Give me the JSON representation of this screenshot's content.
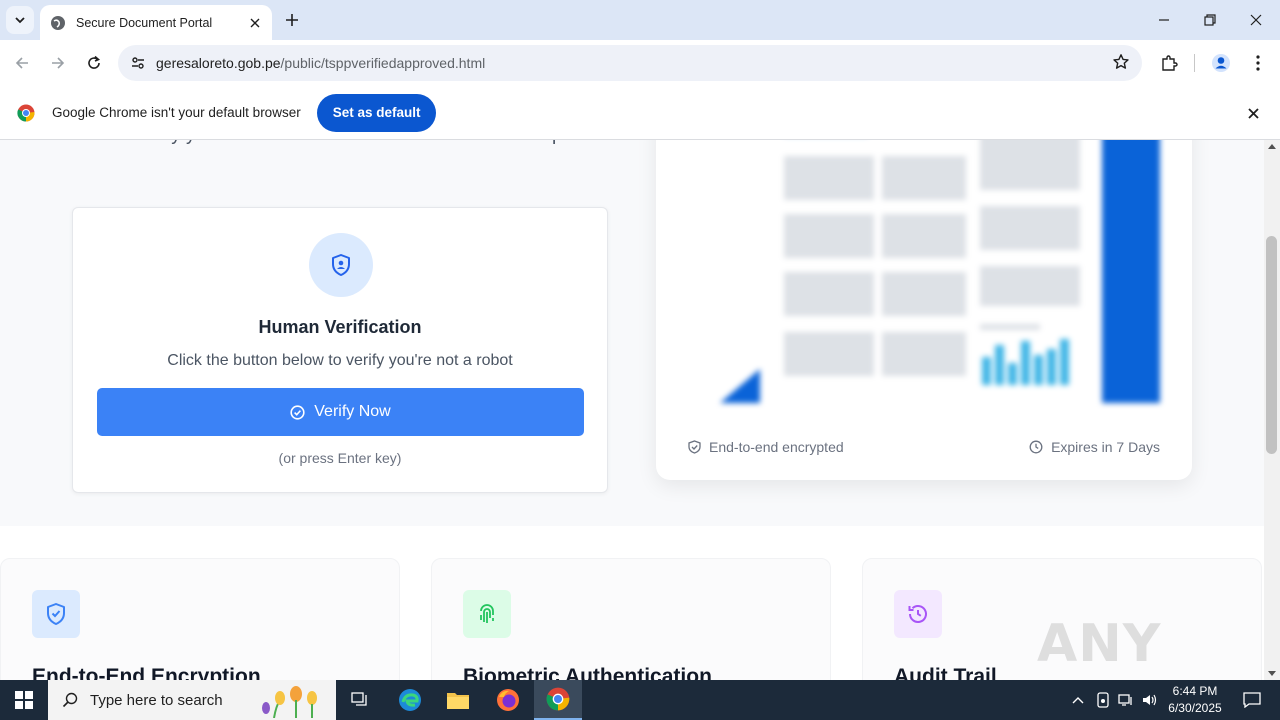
{
  "browser": {
    "tab_title": "Secure Document Portal",
    "url_host": "geresaloreto.gob.pe",
    "url_path": "/public/tsppverifiedapproved.html"
  },
  "infobar": {
    "message": "Google Chrome isn't your default browser",
    "set_default_label": "Set as default"
  },
  "page": {
    "intro_text": "Please verify you're not a robot to continue to the secure portal.",
    "verification": {
      "title": "Human Verification",
      "subtitle": "Click the button below to verify you're not a robot",
      "button_label": "Verify Now",
      "enter_hint": "(or press Enter key)"
    },
    "preview": {
      "encrypted_label": "End-to-end encrypted",
      "expires_label": "Expires in 7 Days"
    },
    "features": [
      {
        "title": "End-to-End Encryption",
        "icon": "shield-check-icon",
        "color": "#3b82f6",
        "bg": "#dbeafe"
      },
      {
        "title": "Biometric Authentication",
        "icon": "fingerprint-icon",
        "color": "#22c55e",
        "bg": "#dcfce7"
      },
      {
        "title": "Audit Trail",
        "icon": "history-icon",
        "color": "#a855f7",
        "bg": "#f3e8ff"
      }
    ]
  },
  "watermark": "ANY RUN",
  "taskbar": {
    "search_placeholder": "Type here to search",
    "time": "6:44 PM",
    "date": "6/30/2025"
  }
}
